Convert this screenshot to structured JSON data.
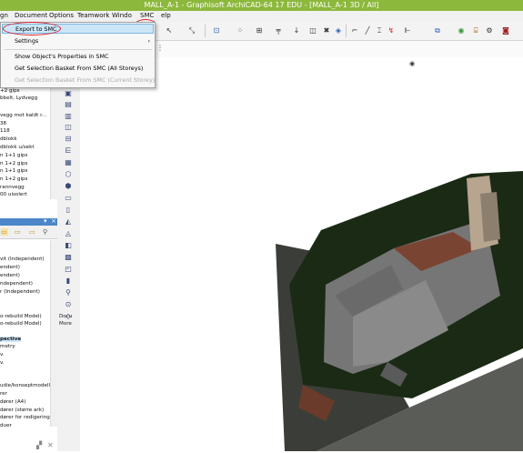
{
  "window": {
    "title": "MALL_A-1 - Graphisoft ArchiCAD-64 17 EDU - [MALL_A-1 3D / All]"
  },
  "menubar": {
    "items": [
      "gn",
      "Document",
      "Options",
      "Teamwork",
      "Window",
      "SMC",
      "Help"
    ],
    "window_short": "Windo",
    "help_short": "elp"
  },
  "smc_menu": {
    "items": [
      {
        "label": "Export to SMC",
        "state": "selected"
      },
      {
        "label": "Settings",
        "state": "normal",
        "submenu": true
      },
      {
        "label": "Show Object's Properties in SMC",
        "state": "normal"
      },
      {
        "label": "Get Selection Basket From SMC (All Storeys)",
        "state": "normal"
      },
      {
        "label": "Get Selection Basket From SMC (Current Storey)",
        "state": "disabled"
      }
    ]
  },
  "left_panel": {
    "list_top": [
      "+2 gips",
      "bbelt, Lydvegg",
      "",
      "vegg mot kaldt r...",
      "38",
      "118",
      "dblokk",
      "dblokk u/sekt",
      "n 1+1 gips",
      "n 1+2 gips",
      "n 1+1 gips",
      "n 1+2 gips",
      "rannvegg",
      "00 uisolert"
    ],
    "list_bottom": [
      "vit (Independent)",
      "endent)",
      "endent)",
      "ndependent)",
      "r (Independent)",
      "",
      "",
      "o-rebuild Model)",
      "o-rebuild Model)",
      "",
      "pective",
      "metry",
      "v.",
      "v.",
      "",
      "",
      "",
      "udie/konseptmodell",
      "rer",
      "dører (A4)",
      "dører (større ark)",
      "dører for redigering",
      "duer"
    ]
  },
  "toolbox": {
    "labels": [
      "Docu",
      "More"
    ]
  },
  "colors": {
    "titlebar": "#8cb83c",
    "highlight_circle": "#d8202a",
    "menu_selected": "#cde6f7",
    "terrain_dark": "#1b2a14",
    "terrain_edge": "#4a4f48",
    "building_grey": "#6c6c6c",
    "brick": "#7a4432"
  }
}
